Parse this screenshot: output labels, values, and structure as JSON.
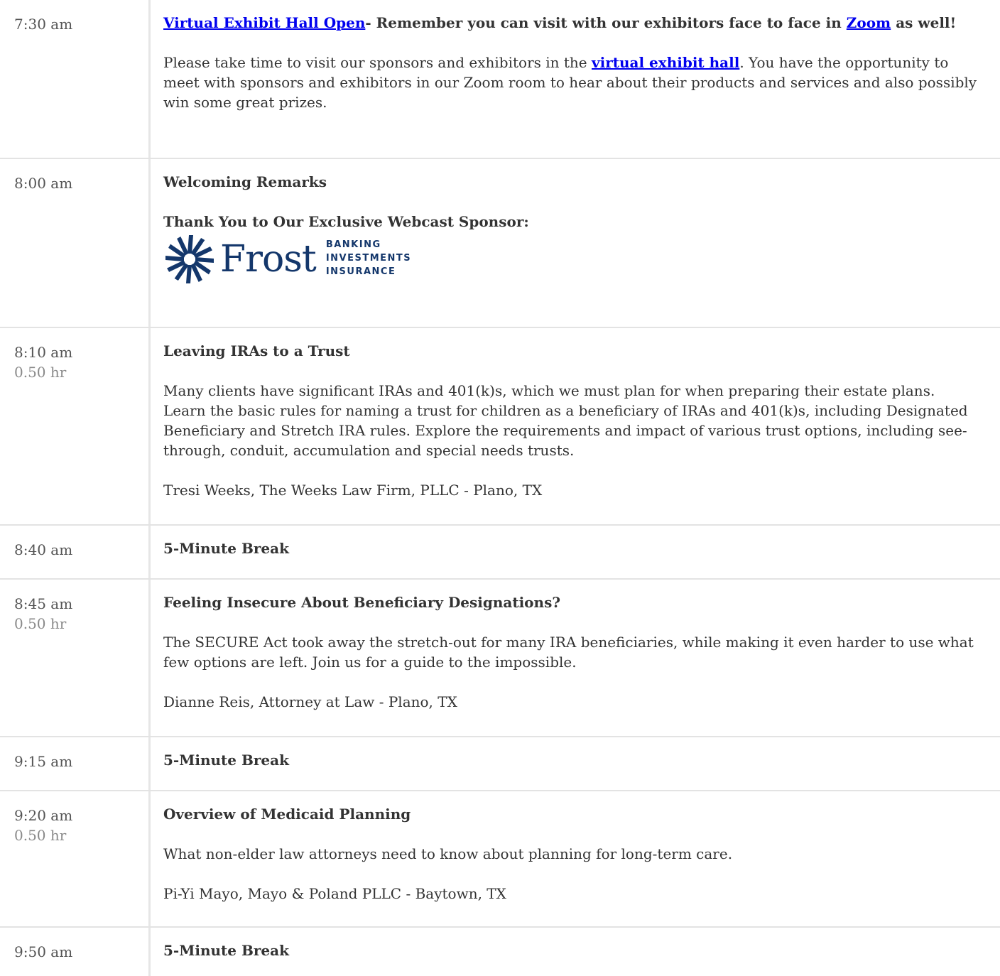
{
  "rows": [
    {
      "time": "7:30 am",
      "title_link": "Virtual Exhibit Hall Open",
      "title_rest": "- Remember you can visit with our exhibitors face to face in ",
      "title_link2": "Zoom",
      "title_end": " as well!",
      "desc_before": "Please take time to visit our sponsors and exhibitors in the ",
      "desc_link": "virtual exhibit hall",
      "desc_after": ". You have the opportunity to meet with sponsors and exhibitors in our Zoom room to hear about their products and services and also possibly win some great prizes."
    },
    {
      "time": "8:00 am",
      "title": "Welcoming Remarks",
      "sponsor_heading": "Thank You to Our Exclusive Webcast Sponsor:",
      "sponsor_logo": {
        "name": "Frost",
        "tags": [
          "BANKING",
          "INVESTMENTS",
          "INSURANCE"
        ],
        "brand_color": "#14376b"
      }
    },
    {
      "time": "8:10 am",
      "duration": "0.50 hr",
      "title": "Leaving IRAs to a Trust",
      "description": "Many clients have significant IRAs and 401(k)s, which we must plan for when preparing their estate plans. Learn the basic rules for naming a trust for children as a beneficiary of IRAs and 401(k)s, including Designated Beneficiary and Stretch IRA rules. Explore the requirements and impact of various trust options, including see-through, conduit, accumulation and special needs trusts.",
      "speaker": "Tresi Weeks, The Weeks Law Firm, PLLC - Plano, TX"
    },
    {
      "time": "8:40 am",
      "title": "5-Minute Break"
    },
    {
      "time": "8:45 am",
      "duration": "0.50 hr",
      "title": "Feeling Insecure About Beneficiary Designations?",
      "description": "The SECURE Act took away the stretch-out for many IRA beneficiaries, while making it even harder to use what few options are left. Join us for a guide to the impossible.",
      "speaker": "Dianne Reis, Attorney at Law - Plano, TX"
    },
    {
      "time": "9:15 am",
      "title": "5-Minute Break"
    },
    {
      "time": "9:20 am",
      "duration": "0.50 hr",
      "title": "Overview of Medicaid Planning",
      "description": "What non-elder law attorneys need to know about planning for long-term care.",
      "speaker": "Pi-Yi Mayo, Mayo & Poland PLLC - Baytown, TX"
    },
    {
      "time": "9:50 am",
      "title": "5-Minute Break"
    }
  ],
  "colors": {
    "text": "#333333",
    "link": "#0000ee",
    "divider": "#e3e3e3",
    "muted": "#8a8a8a"
  }
}
